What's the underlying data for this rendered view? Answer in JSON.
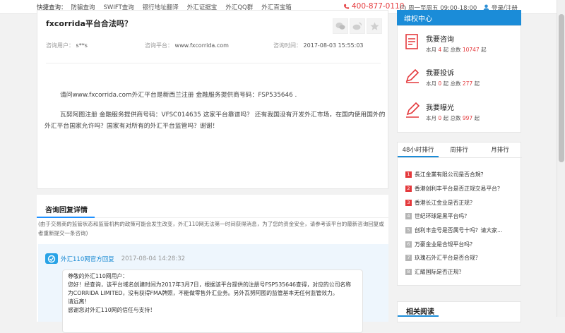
{
  "topbar": {
    "quick_label": "快捷查询：",
    "links": [
      "防骗查询",
      "SWIFT查询",
      "银行地址翻译",
      "外汇证据宝",
      "外汇QQ群",
      "外汇百宝箱"
    ],
    "hotline": "400-877-0110",
    "hours": "周一至周五 09:00-18:00",
    "login": "登录",
    "sep": "/",
    "register": "注册"
  },
  "question": {
    "title": "fxcorrida平台合法吗？",
    "user_label": "咨询用户：",
    "user": "s**s",
    "platform_label": "咨询平台：",
    "platform": "www.fxcorrida.com",
    "time_label": "咨询时间：",
    "time": "2017-08-03 15:55:03",
    "paragraphs": [
      "请问www.fxcorrida.com外汇平台是新西兰注册  金融服务提供商号码：FSP535646 .",
      "瓦努阿图注册  金融服务提供商号码：VFSC014635 这家平台靠谱吗？ 还有我国没有开发外汇市场，在国内使用国外的外汇平台国家允许吗？国家有对所有的外汇平台监管吗？谢谢！"
    ]
  },
  "reply": {
    "section_title": "咨询回复详情",
    "note": "(由于交易商的监管状态和监管机构的政策可能会发生改变，外汇110网无法第一时间获得消息，为了您的资金安全，请参考该平台的最新咨询回复或者重新提交一条咨询)",
    "author": "外汇110网官方回复",
    "time": "2017-08-04 14:28:32",
    "lines": [
      "尊敬的外汇110网用户：",
      "您好！经查询，该平台域名创建时间为2017年3月7日，根据该平台提供的注册号FSP535646查得，对应的公司名称",
      "为CORRIDA LIMITED，没有获得FMA牌照，不能做零售外汇业务。另外瓦努阿图的监管基本无任何监管效力。",
      "请远离！",
      "感谢您对外汇110网的信任与支持！"
    ]
  },
  "sidebar": {
    "header": "维权中心",
    "items": [
      {
        "title": "我要咨询",
        "month_label": "本月",
        "month": "4",
        "unit": "起",
        "total_label": "总数",
        "total": "10747"
      },
      {
        "title": "我要投诉",
        "month_label": "本月",
        "month": "0",
        "unit": "起",
        "total_label": "总数",
        "total": "277"
      },
      {
        "title": "我要曝光",
        "month_label": "本月",
        "month": "0",
        "unit": "起",
        "total_label": "总数",
        "total": "997"
      }
    ],
    "rank_tabs": [
      "48小时排行",
      "周排行",
      "月排行"
    ],
    "rank_items": [
      "長江金業有限公司是否合規？",
      "香港创利丰平台是否正规交易平台？",
      "香港长江金业是否正规？",
      "世纪环球是黑平台吗？",
      "创利丰金号是否属号十吗？请大家...",
      "万豪金业是合规平台吗？",
      "玖瑰石外汇平台是否合规？",
      "汇耀国际是否正规？"
    ],
    "related_title": "相关阅读"
  },
  "colors": {
    "accent": "#1b8cd8",
    "hot": "#e4393c",
    "reply_bg": "#eef6fd"
  }
}
